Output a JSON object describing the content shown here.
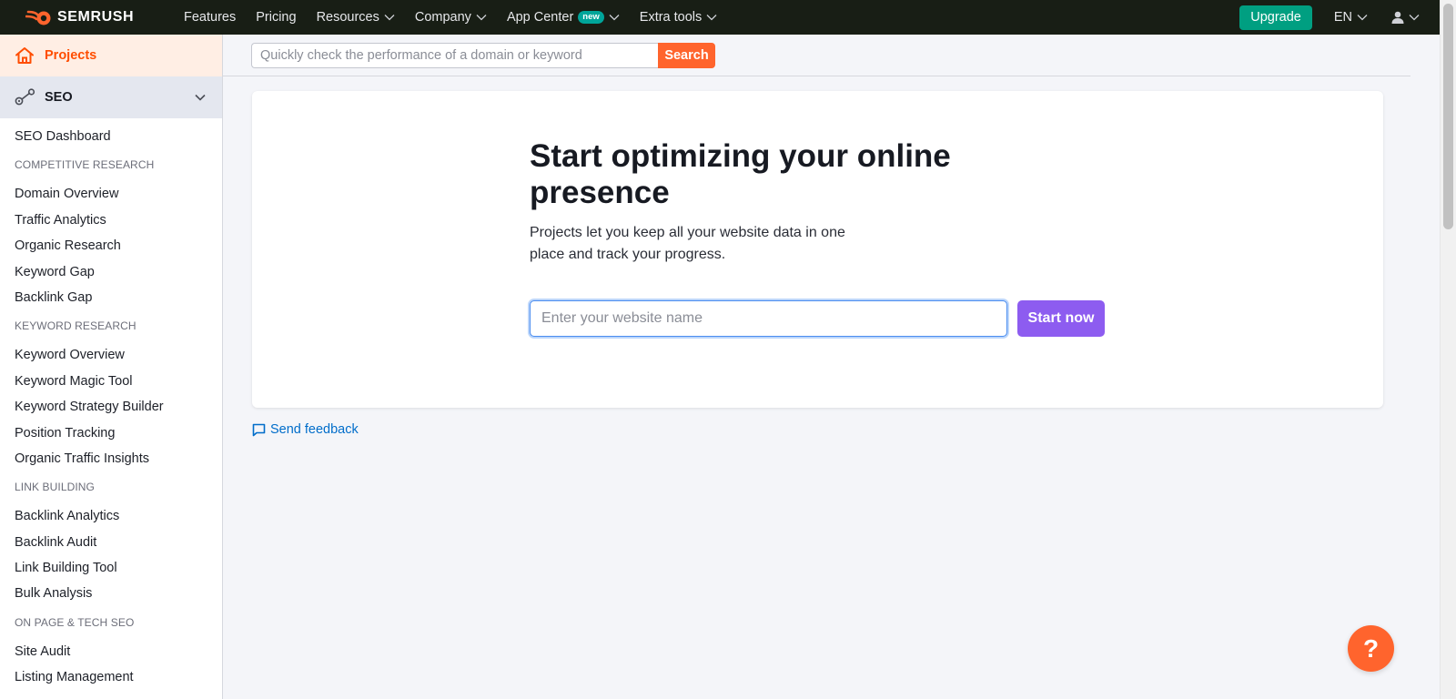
{
  "topbar": {
    "brand": "SEMRUSH",
    "nav": [
      {
        "label": "Features",
        "dropdown": false
      },
      {
        "label": "Pricing",
        "dropdown": false
      },
      {
        "label": "Resources",
        "dropdown": true
      },
      {
        "label": "Company",
        "dropdown": true
      },
      {
        "label": "App Center",
        "dropdown": true,
        "badge": "new"
      },
      {
        "label": "Extra tools",
        "dropdown": true
      }
    ],
    "upgrade_label": "Upgrade",
    "language": "EN"
  },
  "sidebar": {
    "projects_label": "Projects",
    "seo_label": "SEO",
    "dashboard": "SEO Dashboard",
    "sections": [
      {
        "heading": "COMPETITIVE RESEARCH",
        "items": [
          "Domain Overview",
          "Traffic Analytics",
          "Organic Research",
          "Keyword Gap",
          "Backlink Gap"
        ]
      },
      {
        "heading": "KEYWORD RESEARCH",
        "items": [
          "Keyword Overview",
          "Keyword Magic Tool",
          "Keyword Strategy Builder",
          "Position Tracking",
          "Organic Traffic Insights"
        ]
      },
      {
        "heading": "LINK BUILDING",
        "items": [
          "Backlink Analytics",
          "Backlink Audit",
          "Link Building Tool",
          "Bulk Analysis"
        ]
      },
      {
        "heading": "ON PAGE & TECH SEO",
        "items": [
          "Site Audit",
          "Listing Management"
        ]
      }
    ]
  },
  "search": {
    "placeholder": "Quickly check the performance of a domain or keyword",
    "button_label": "Search"
  },
  "hero": {
    "title": "Start optimizing your online presence",
    "subtitle": "Projects let you keep all your website data in one place and track your progress.",
    "input_placeholder": "Enter your website name",
    "button_label": "Start now"
  },
  "feedback_label": "Send feedback",
  "help_label": "?",
  "colors": {
    "topbar_bg": "#181e15",
    "accent_orange": "#ff642d",
    "upgrade_green": "#009f81",
    "start_purple": "#8d5cf0",
    "link_blue": "#006dca",
    "badge_teal": "#00a59a"
  }
}
